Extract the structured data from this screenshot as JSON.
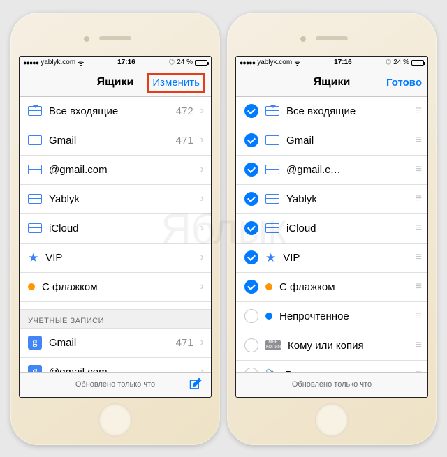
{
  "watermark": "Яблык",
  "status": {
    "carrier": "yablyk.com",
    "time": "17:16",
    "battery_pct": "24 %",
    "battery_fill_pct": 24
  },
  "left": {
    "nav": {
      "title": "Ящики",
      "right": "Изменить"
    },
    "rows": [
      {
        "icon": "tray-down",
        "label": "Все входящие",
        "count": "472"
      },
      {
        "icon": "tray",
        "label": "Gmail",
        "count": "471"
      },
      {
        "icon": "tray",
        "label": "@gmail.com",
        "count": ""
      },
      {
        "icon": "tray",
        "label": "Yablyk",
        "count": ""
      },
      {
        "icon": "tray",
        "label": "iCloud",
        "count": ""
      },
      {
        "icon": "star",
        "label": "VIP",
        "count": ""
      },
      {
        "icon": "dot-orange",
        "label": "С флажком",
        "count": ""
      }
    ],
    "section": "УЧЕТНЫЕ ЗАПИСИ",
    "accounts": [
      {
        "icon": "g",
        "label": "Gmail",
        "count": "471"
      },
      {
        "icon": "g",
        "label": "@gmail.com",
        "count": ""
      }
    ]
  },
  "right": {
    "nav": {
      "title": "Ящики",
      "right": "Готово"
    },
    "rows": [
      {
        "checked": true,
        "icon": "tray-down",
        "label": "Все входящие"
      },
      {
        "checked": true,
        "icon": "tray",
        "label": "Gmail"
      },
      {
        "checked": true,
        "icon": "tray",
        "label": "@gmail.c…"
      },
      {
        "checked": true,
        "icon": "tray",
        "label": "Yablyk"
      },
      {
        "checked": true,
        "icon": "tray",
        "label": "iCloud"
      },
      {
        "checked": true,
        "icon": "star",
        "label": "VIP"
      },
      {
        "checked": true,
        "icon": "dot-orange",
        "label": "С флажком"
      },
      {
        "checked": false,
        "icon": "dot-blue",
        "label": "Непрочтенное"
      },
      {
        "checked": false,
        "icon": "badge",
        "label": "Кому или копия"
      },
      {
        "checked": false,
        "icon": "clip",
        "label": "Вложения"
      }
    ]
  },
  "toolbar_text": "Обновлено только что"
}
